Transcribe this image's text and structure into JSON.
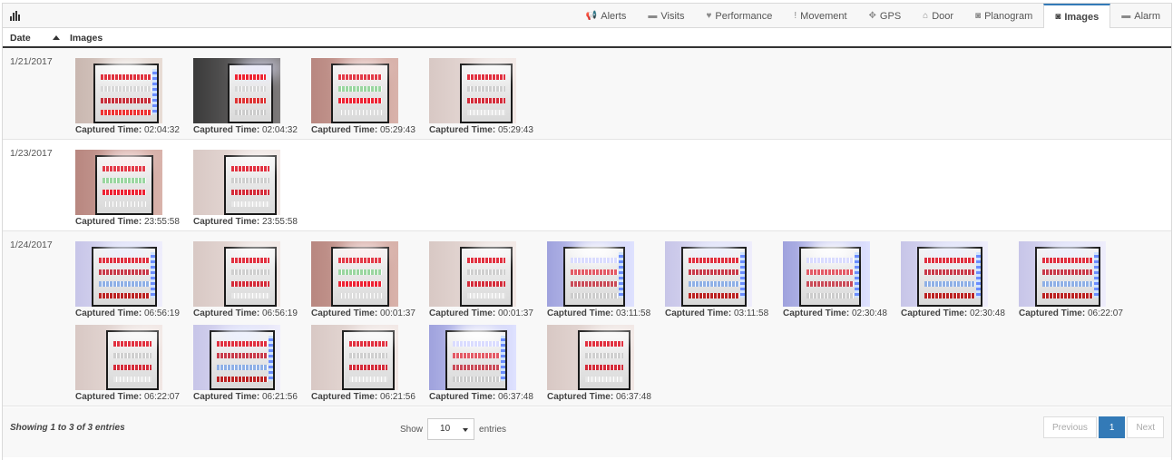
{
  "tabs": [
    {
      "label": "Alerts",
      "icon": "megaphone-icon",
      "glyph": "📢",
      "active": false
    },
    {
      "label": "Visits",
      "icon": "briefcase-icon",
      "glyph": "▬",
      "active": false
    },
    {
      "label": "Performance",
      "icon": "heart-icon",
      "glyph": "♥",
      "active": false
    },
    {
      "label": "Movement",
      "icon": "exclamation-icon",
      "glyph": "!",
      "active": false
    },
    {
      "label": "GPS",
      "icon": "crosshair-icon",
      "glyph": "✥",
      "active": false
    },
    {
      "label": "Door",
      "icon": "home-icon",
      "glyph": "⌂",
      "active": false
    },
    {
      "label": "Planogram",
      "icon": "camera-icon",
      "glyph": "◙",
      "active": false
    },
    {
      "label": "Images",
      "icon": "camera-icon",
      "glyph": "◙",
      "active": true
    },
    {
      "label": "Alarm",
      "icon": "briefcase-icon",
      "glyph": "▬",
      "active": false
    }
  ],
  "table": {
    "headers": {
      "date": "Date",
      "images": "Images"
    },
    "caption_label": "Captured Time:",
    "rows": [
      {
        "date": "1/21/2017",
        "images": [
          {
            "time": "02:04:32",
            "style": "bright"
          },
          {
            "time": "02:04:32",
            "style": "dark"
          },
          {
            "time": "05:29:43",
            "style": "warm"
          },
          {
            "time": "05:29:43",
            "style": "pale"
          }
        ]
      },
      {
        "date": "1/23/2017",
        "images": [
          {
            "time": "23:55:58",
            "style": "warm"
          },
          {
            "time": "23:55:58",
            "style": "pale"
          }
        ]
      },
      {
        "date": "1/24/2017",
        "images": [
          {
            "time": "06:56:19",
            "style": "blue"
          },
          {
            "time": "06:56:19",
            "style": "pale"
          },
          {
            "time": "00:01:37",
            "style": "warm"
          },
          {
            "time": "00:01:37",
            "style": "pale"
          },
          {
            "time": "03:11:58",
            "style": "glare"
          },
          {
            "time": "03:11:58",
            "style": "blue"
          },
          {
            "time": "02:30:48",
            "style": "glare"
          },
          {
            "time": "02:30:48",
            "style": "blue"
          },
          {
            "time": "06:22:07",
            "style": "blue"
          },
          {
            "time": "06:22:07",
            "style": "pale"
          },
          {
            "time": "06:21:56",
            "style": "blue"
          },
          {
            "time": "06:21:56",
            "style": "pale"
          },
          {
            "time": "06:37:48",
            "style": "glare"
          },
          {
            "time": "06:37:48",
            "style": "pale"
          }
        ]
      }
    ]
  },
  "footer": {
    "info": "Showing 1 to 3 of 3 entries",
    "show_label": "Show",
    "page_size": "10",
    "entries_label": "entries",
    "previous": "Previous",
    "current_page": "1",
    "next": "Next"
  },
  "colors": {
    "accent": "#337ab7",
    "header_rule": "#333333",
    "stripe": "#f8f8f8"
  }
}
